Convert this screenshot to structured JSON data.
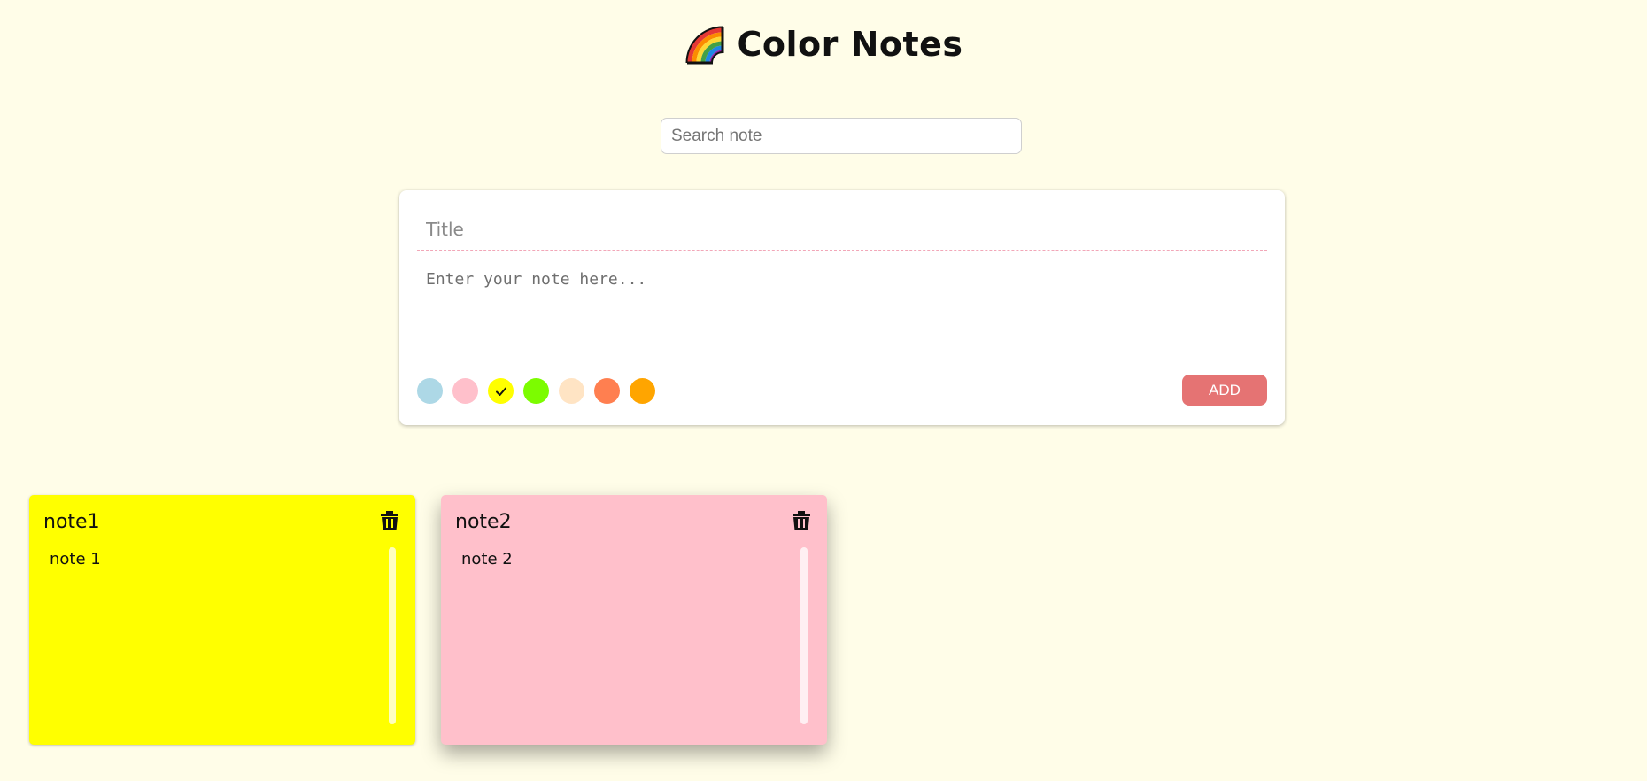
{
  "app": {
    "title": "Color Notes",
    "icon": "rainbow-icon"
  },
  "search": {
    "placeholder": "Search note",
    "value": ""
  },
  "composer": {
    "title_placeholder": "Title",
    "note_placeholder": "Enter your note here...",
    "add_label": "ADD",
    "add_color": "#e57373",
    "colors": [
      "#add8e6",
      "#ffc0cb",
      "#ffff00",
      "#7cfc00",
      "#ffe4c4",
      "#ff7f50",
      "#ffa500"
    ],
    "selected_color": "#ffff00"
  },
  "notes": [
    {
      "title": "note1",
      "body": "note 1",
      "color": "#ffff00",
      "icon": "trash-icon"
    },
    {
      "title": "note2",
      "body": "note 2",
      "color": "#ffc0cb",
      "icon": "trash-icon"
    }
  ]
}
